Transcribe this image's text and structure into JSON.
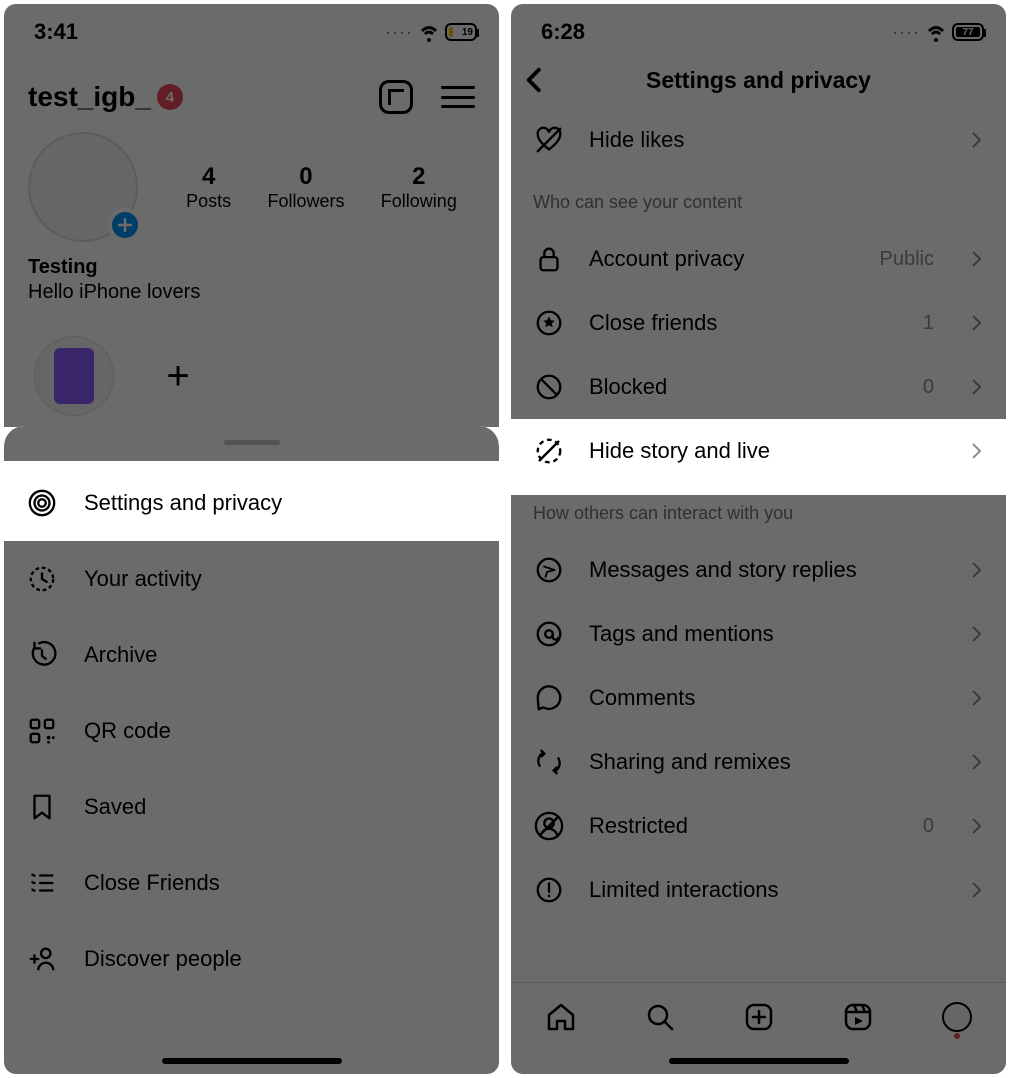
{
  "left": {
    "status": {
      "time": "3:41",
      "battery": "19"
    },
    "header": {
      "username": "test_igb_",
      "badge": "4"
    },
    "stats": {
      "posts": {
        "count": "4",
        "label": "Posts"
      },
      "followers": {
        "count": "0",
        "label": "Followers"
      },
      "following": {
        "count": "2",
        "label": "Following"
      }
    },
    "bio": {
      "name": "Testing",
      "text": "Hello iPhone lovers"
    },
    "sheet": {
      "items": [
        {
          "icon": "gear",
          "label": "Settings and privacy"
        },
        {
          "icon": "activity",
          "label": "Your activity"
        },
        {
          "icon": "archive",
          "label": "Archive"
        },
        {
          "icon": "qr",
          "label": "QR code"
        },
        {
          "icon": "saved",
          "label": "Saved"
        },
        {
          "icon": "close-friends",
          "label": "Close Friends"
        },
        {
          "icon": "discover",
          "label": "Discover people"
        }
      ]
    }
  },
  "right": {
    "status": {
      "time": "6:28",
      "battery": "77"
    },
    "title": "Settings and privacy",
    "rows_top": [
      {
        "icon": "hide-likes",
        "label": "Hide likes"
      }
    ],
    "section1": "Who can see your content",
    "rows_content": [
      {
        "icon": "lock",
        "label": "Account privacy",
        "value": "Public"
      },
      {
        "icon": "star-circle",
        "label": "Close friends",
        "value": "1"
      },
      {
        "icon": "blocked",
        "label": "Blocked",
        "value": "0"
      },
      {
        "icon": "hide-story",
        "label": "Hide story and live"
      }
    ],
    "section2": "How others can interact with you",
    "rows_interact": [
      {
        "icon": "messages",
        "label": "Messages and story replies"
      },
      {
        "icon": "mentions",
        "label": "Tags and mentions"
      },
      {
        "icon": "comments",
        "label": "Comments"
      },
      {
        "icon": "sharing",
        "label": "Sharing and remixes"
      },
      {
        "icon": "restricted",
        "label": "Restricted",
        "value": "0"
      },
      {
        "icon": "limited",
        "label": "Limited interactions"
      }
    ]
  }
}
